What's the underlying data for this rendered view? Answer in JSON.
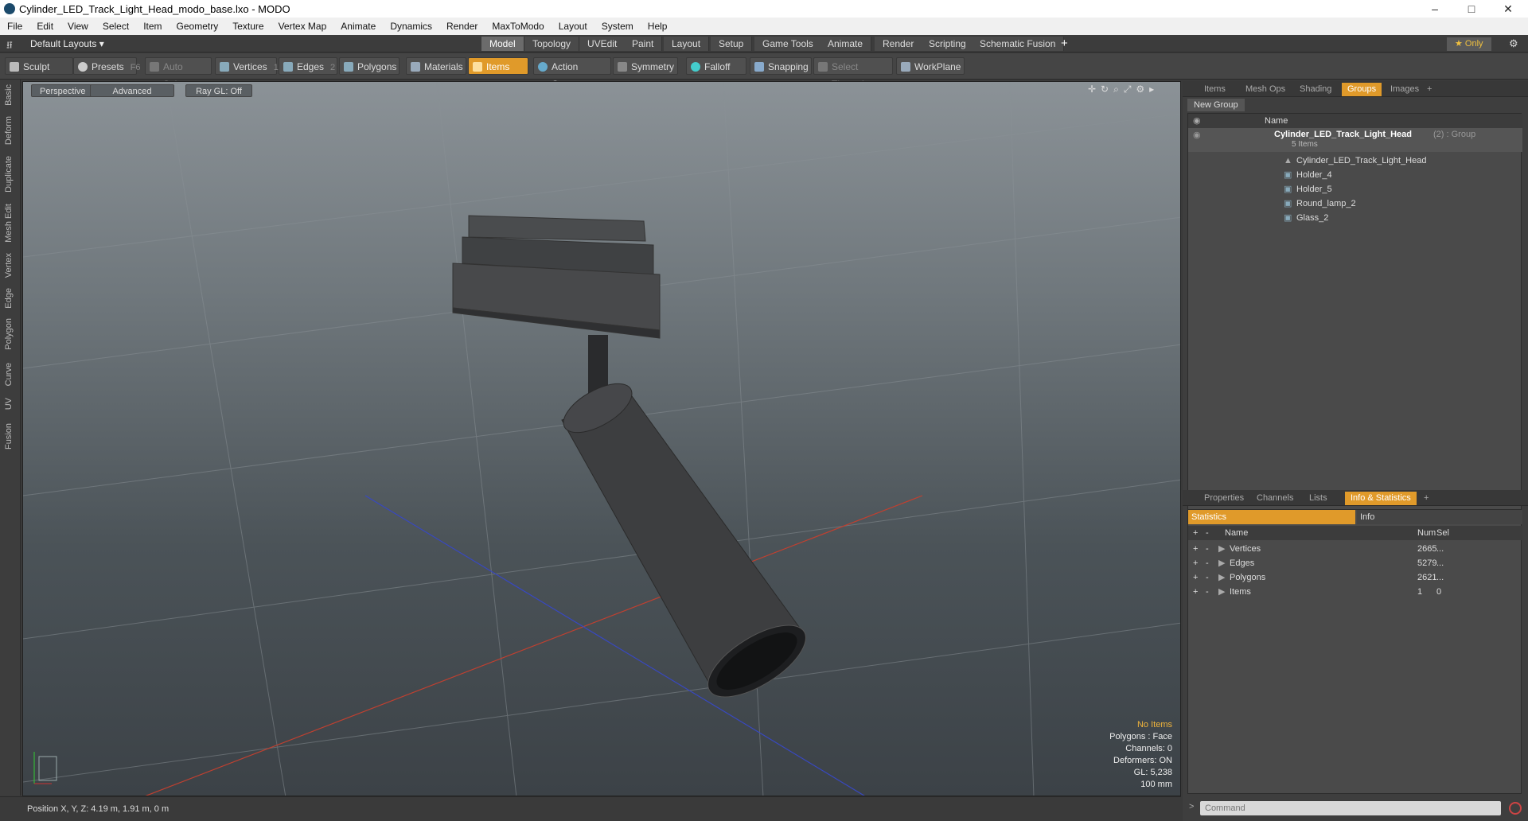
{
  "window": {
    "title": "Cylinder_LED_Track_Light_Head_modo_base.lxo - MODO",
    "controls": [
      "–",
      "□",
      "✕"
    ]
  },
  "menu": [
    "File",
    "Edit",
    "View",
    "Select",
    "Item",
    "Geometry",
    "Texture",
    "Vertex Map",
    "Animate",
    "Dynamics",
    "Render",
    "MaxToModo",
    "Layout",
    "System",
    "Help"
  ],
  "layoutbar": {
    "layouts_label": "Default Layouts ▾",
    "tabs": [
      "Model",
      "Topology",
      "UVEdit",
      "Paint",
      "Layout",
      "Setup",
      "Game Tools",
      "Animate",
      "Render",
      "Scripting",
      "Schematic Fusion"
    ],
    "active_tab": "Model",
    "only_label": "★  Only"
  },
  "toolbar": {
    "sculpt": "Sculpt",
    "presets": "Presets",
    "presets_key": "F6",
    "auto_select": "Auto Select",
    "vertices": "Vertices",
    "vertices_count": "1",
    "edges": "Edges",
    "edges_count": "2",
    "polygons": "Polygons",
    "materials": "Materials",
    "items": "Items",
    "action_center": "Action Center",
    "symmetry": "Symmetry",
    "falloff": "Falloff",
    "snapping": "Snapping",
    "select_through": "Select Through",
    "workplane": "WorkPlane"
  },
  "lefttabs": [
    "Basic",
    "Deform",
    "Duplicate",
    "Mesh Edit",
    "Vertex",
    "Edge",
    "Polygon",
    "Curve",
    "UV",
    "Fusion"
  ],
  "viewport": {
    "view": "Perspective",
    "shading": "Advanced",
    "raygl": "Ray GL: Off",
    "info": {
      "selection": "No Items",
      "polygons": "Polygons : Face",
      "channels": "Channels: 0",
      "deformers": "Deformers: ON",
      "gl": "GL: 5,238",
      "scale": "100 mm"
    }
  },
  "status": {
    "position": "Position X, Y, Z:   4.19 m, 1.91 m, 0 m"
  },
  "groups_panel": {
    "tabs": [
      "Items",
      "Mesh Ops",
      "Shading",
      "Groups",
      "Images",
      "+"
    ],
    "active_tab": "Groups",
    "new_group": "New Group",
    "column_name": "Name",
    "group_name": "Cylinder_LED_Track_Light_Head",
    "group_suffix": "(2) : Group",
    "group_count": "5 Items",
    "children": [
      "Cylinder_LED_Track_Light_Head",
      "Holder_4",
      "Holder_5",
      "Round_lamp_2",
      "Glass_2"
    ]
  },
  "stats_panel": {
    "tabs": [
      "Properties",
      "Channels",
      "Lists",
      "Info & Statistics",
      "+"
    ],
    "active_tab": "Info & Statistics",
    "subtabs": [
      "Statistics",
      "Info"
    ],
    "columns": [
      "Name",
      "Num",
      "Sel"
    ],
    "rows": [
      {
        "name": "Vertices",
        "num": "2665",
        "sel": "..."
      },
      {
        "name": "Edges",
        "num": "5279",
        "sel": "..."
      },
      {
        "name": "Polygons",
        "num": "2621",
        "sel": "..."
      },
      {
        "name": "Items",
        "num": "1",
        "sel": "0"
      }
    ]
  },
  "command": {
    "placeholder": "Command"
  }
}
